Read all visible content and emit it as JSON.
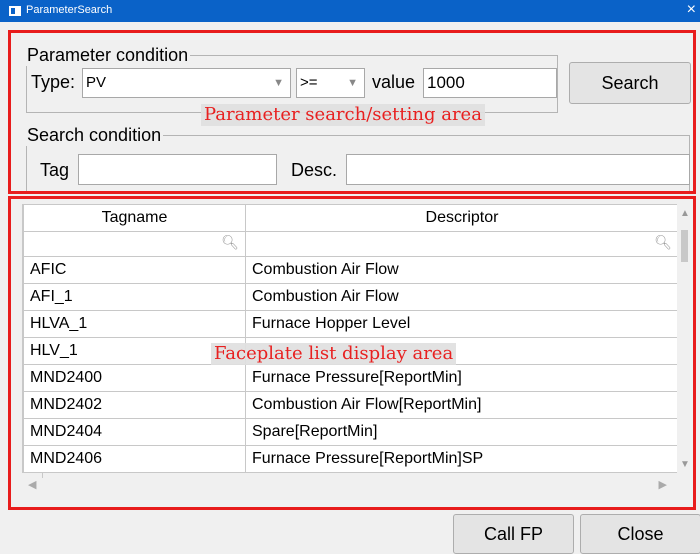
{
  "window": {
    "title": "ParameterSearch",
    "close_glyph": "×"
  },
  "parameter_condition": {
    "legend": "Parameter condition",
    "type_label": "Type:",
    "type_value": "PV",
    "operator_value": ">=",
    "value_label": "value",
    "value_input": "1000",
    "search_button": "Search"
  },
  "search_condition": {
    "legend": "Search condition",
    "tag_label": "Tag",
    "tag_value": "",
    "desc_label": "Desc.",
    "desc_value": ""
  },
  "annotations": {
    "parameter_area": "Parameter search/setting area",
    "faceplate_area": "Faceplate list display area"
  },
  "table": {
    "columns": [
      "Tagname",
      "Descriptor"
    ],
    "rows": [
      [
        "AFIC",
        "Combustion Air Flow"
      ],
      [
        "AFI_1",
        "Combustion Air Flow"
      ],
      [
        "HLVA_1",
        "Furnace Hopper Level"
      ],
      [
        "HLV_1",
        ""
      ],
      [
        "MND2400",
        "Furnace Pressure[ReportMin]"
      ],
      [
        "MND2402",
        "Combustion Air Flow[ReportMin]"
      ],
      [
        "MND2404",
        "Spare[ReportMin]"
      ],
      [
        "MND2406",
        "Furnace Pressure[ReportMin]SP"
      ]
    ]
  },
  "footer": {
    "call_fp": "Call FP",
    "close": "Close"
  },
  "colors": {
    "titlebar": "#0a62c8",
    "highlight_border": "#e81c1c",
    "annotation_text": "#e82020"
  }
}
